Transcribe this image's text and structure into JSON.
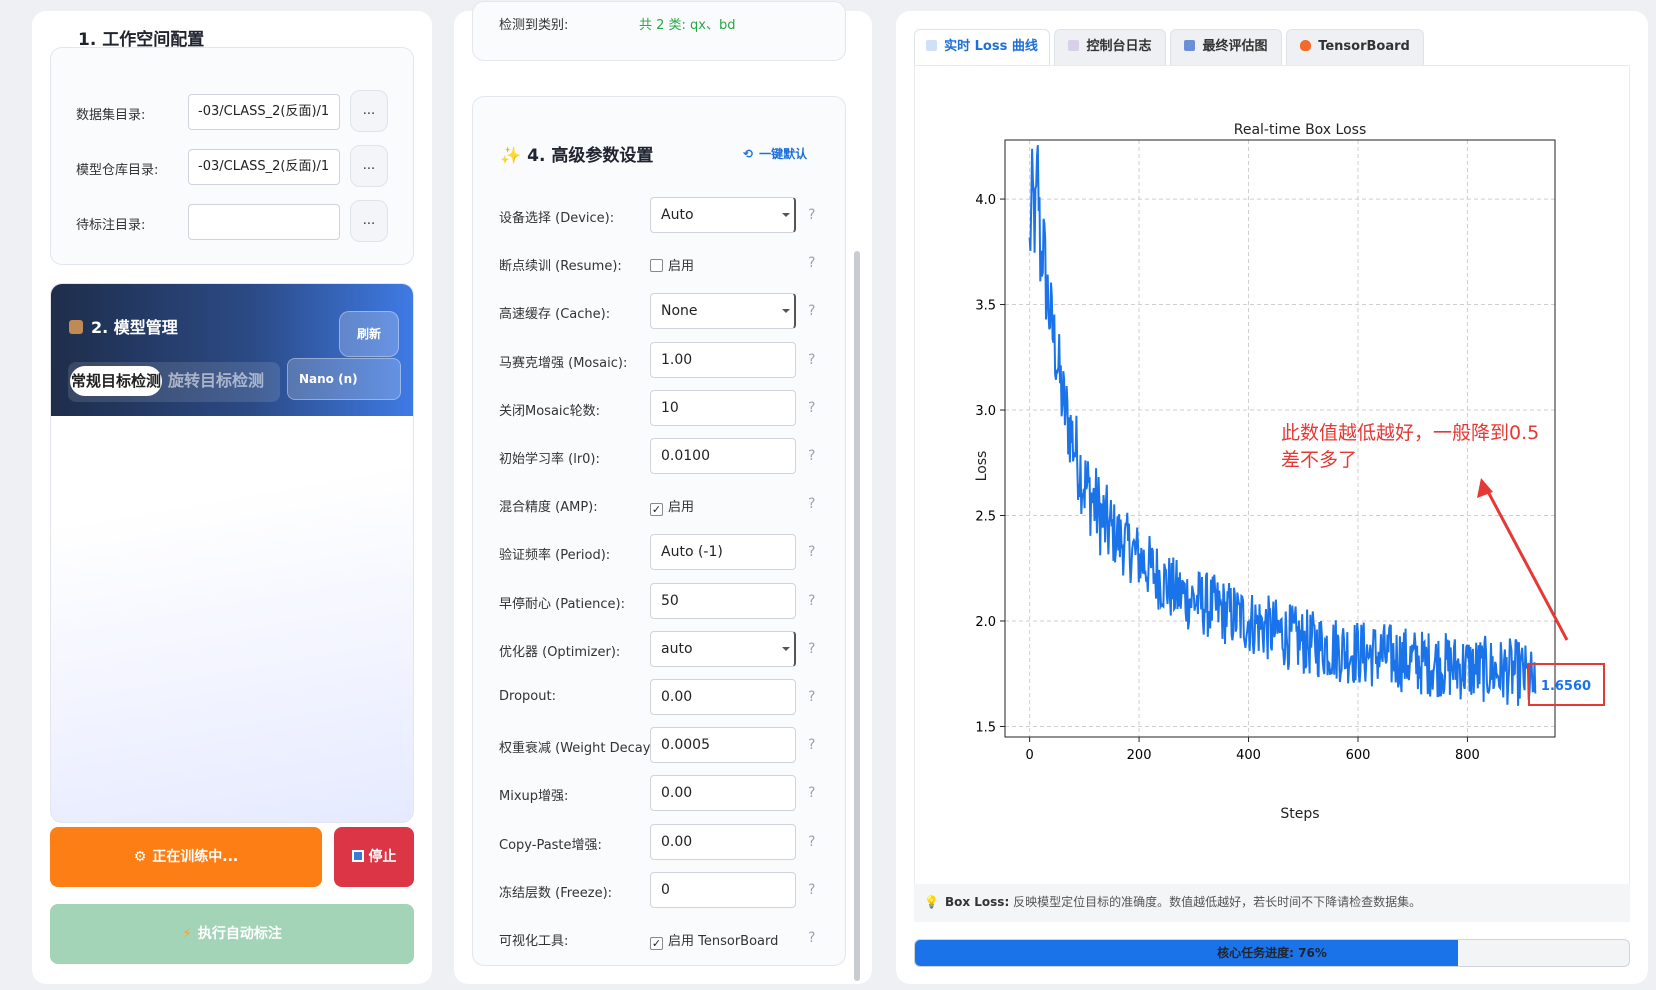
{
  "workspace": {
    "title": "1. 工作空间配置",
    "fields": [
      {
        "label": "数据集目录:",
        "value": "-03/CLASS_2(反面)/1",
        "button": "..."
      },
      {
        "label": "模型仓库目录:",
        "value": "-03/CLASS_2(反面)/1",
        "button": "..."
      },
      {
        "label": "待标注目录:",
        "value": "",
        "button": "..."
      }
    ]
  },
  "model": {
    "title": "2. 模型管理",
    "refresh_label": "刷新",
    "seg_active": "常规目标检测",
    "seg_inactive": "旋转目标检测",
    "selected_model": "Nano (n)"
  },
  "actions": {
    "train_label": "正在训练中...",
    "stop_label": "停止",
    "auto_label_label": "执行自动标注"
  },
  "detected": {
    "label": "检测到类别:",
    "value": "共 2 类: qx、bd"
  },
  "advanced": {
    "title": "4. 高级参数设置",
    "reset_label": "一键默认",
    "params": [
      {
        "label": "设备选择 (Device):",
        "type": "select",
        "value": "Auto"
      },
      {
        "label": "断点续训 (Resume):",
        "type": "check",
        "checked": false,
        "text": "启用"
      },
      {
        "label": "高速缓存 (Cache):",
        "type": "select",
        "value": "None"
      },
      {
        "label": "马赛克增强 (Mosaic):",
        "type": "input",
        "value": "1.00"
      },
      {
        "label": "关闭Mosaic轮数:",
        "type": "input",
        "value": "10"
      },
      {
        "label": "初始学习率 (lr0):",
        "type": "input",
        "value": "0.0100"
      },
      {
        "label": "混合精度 (AMP):",
        "type": "check",
        "checked": true,
        "text": "启用"
      },
      {
        "label": "验证频率 (Period):",
        "type": "input",
        "value": "Auto (-1)"
      },
      {
        "label": "早停耐心 (Patience):",
        "type": "input",
        "value": "50"
      },
      {
        "label": "优化器 (Optimizer):",
        "type": "select",
        "value": "auto"
      },
      {
        "label": "Dropout:",
        "type": "input",
        "value": "0.00"
      },
      {
        "label": "权重衰减 (Weight Decay):",
        "type": "input",
        "value": "0.0005"
      },
      {
        "label": "Mixup增强:",
        "type": "input",
        "value": "0.00"
      },
      {
        "label": "Copy-Paste增强:",
        "type": "input",
        "value": "0.00"
      },
      {
        "label": "冻结层数 (Freeze):",
        "type": "input",
        "value": "0"
      },
      {
        "label": "可视化工具:",
        "type": "check",
        "checked": true,
        "text": "启用 TensorBoard"
      }
    ],
    "help": "?"
  },
  "tabs": [
    {
      "label": "实时 Loss 曲线",
      "icon": "chart-icon",
      "active": true
    },
    {
      "label": "控制台日志",
      "icon": "console-icon",
      "active": false
    },
    {
      "label": "最终评估图",
      "icon": "bar-chart-icon",
      "active": false
    },
    {
      "label": "TensorBoard",
      "icon": "flame-icon",
      "active": false
    }
  ],
  "chart_data": {
    "type": "line",
    "title": "Real-time Box Loss",
    "xlabel": "Steps",
    "ylabel": "Loss",
    "xlim": [
      -45,
      960
    ],
    "ylim": [
      1.45,
      4.28
    ],
    "xticks": [
      0,
      200,
      400,
      600,
      800
    ],
    "yticks": [
      1.5,
      2.0,
      2.5,
      3.0,
      3.5,
      4.0
    ],
    "grid": true,
    "color": "#1a73e8",
    "anchor_points": [
      [
        0,
        3.75
      ],
      [
        5,
        4.05
      ],
      [
        10,
        3.85
      ],
      [
        15,
        4.15
      ],
      [
        20,
        3.7
      ],
      [
        25,
        3.8
      ],
      [
        30,
        3.6
      ],
      [
        40,
        3.4
      ],
      [
        50,
        3.25
      ],
      [
        60,
        3.05
      ],
      [
        70,
        2.95
      ],
      [
        80,
        2.85
      ],
      [
        90,
        2.75
      ],
      [
        100,
        2.65
      ],
      [
        120,
        2.55
      ],
      [
        140,
        2.45
      ],
      [
        160,
        2.4
      ],
      [
        180,
        2.35
      ],
      [
        200,
        2.3
      ],
      [
        220,
        2.25
      ],
      [
        240,
        2.2
      ],
      [
        260,
        2.15
      ],
      [
        280,
        2.12
      ],
      [
        300,
        2.1
      ],
      [
        320,
        2.08
      ],
      [
        340,
        2.06
      ],
      [
        360,
        2.04
      ],
      [
        380,
        2.02
      ],
      [
        400,
        2.0
      ],
      [
        420,
        1.98
      ],
      [
        440,
        1.96
      ],
      [
        460,
        1.94
      ],
      [
        480,
        1.92
      ],
      [
        500,
        1.9
      ],
      [
        520,
        1.89
      ],
      [
        540,
        1.88
      ],
      [
        560,
        1.87
      ],
      [
        580,
        1.86
      ],
      [
        600,
        1.85
      ],
      [
        620,
        1.84
      ],
      [
        640,
        1.84
      ],
      [
        660,
        1.83
      ],
      [
        680,
        1.82
      ],
      [
        700,
        1.81
      ],
      [
        720,
        1.8
      ],
      [
        740,
        1.8
      ],
      [
        760,
        1.79
      ],
      [
        780,
        1.78
      ],
      [
        800,
        1.78
      ],
      [
        820,
        1.77
      ],
      [
        840,
        1.77
      ],
      [
        860,
        1.76
      ],
      [
        880,
        1.76
      ],
      [
        900,
        1.75
      ],
      [
        920,
        1.7
      ],
      [
        925,
        1.656
      ]
    ],
    "last_value_label": "1.6560",
    "annotation": "此数值越低越好，一般降到0.5差不多了"
  },
  "hint": {
    "icon": "bulb-icon",
    "bold": "Box Loss:",
    "text": " 反映模型定位目标的准确度。数值越低越好，若长时间不下降请检查数据集。"
  },
  "progress": {
    "value": 0.76,
    "label": "核心任务进度: 76%"
  },
  "colors": {
    "accent": "#1a73e8",
    "train": "#fd7e14",
    "stop": "#dc3545",
    "auto_label": "#a4d4b8",
    "annotation": "#e53935"
  }
}
